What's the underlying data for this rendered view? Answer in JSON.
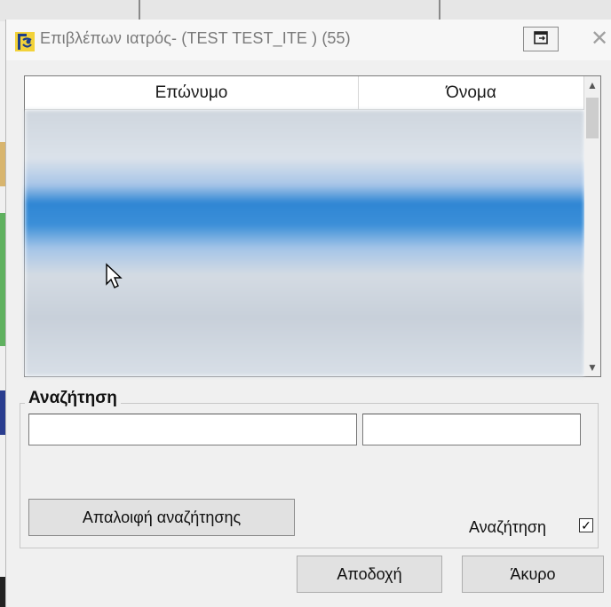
{
  "window": {
    "title": "Επιβλέπων ιατρός-  (TEST TEST_ITE ) (55)",
    "icon": "app-logo-icon",
    "restore_icon": "restore-window-icon",
    "close_glyph": "✕"
  },
  "list": {
    "columns": [
      {
        "label": "Επώνυμο"
      },
      {
        "label": "Όνομα"
      }
    ],
    "scroll_up_glyph": "▲",
    "scroll_down_glyph": "▼",
    "rows_blurred": true
  },
  "search": {
    "group_label": "Αναζήτηση",
    "surname_value": "",
    "name_value": "",
    "clear_label": "Απαλοιφή αναζήτησης",
    "checkbox_label": "Αναζήτηση",
    "checkbox_checked": true,
    "check_glyph": "✓"
  },
  "actions": {
    "accept_label": "Αποδοχή",
    "cancel_label": "Άκυρο"
  },
  "colors": {
    "selection": "#3b8fd8",
    "window_bg": "#f0f0f0"
  }
}
